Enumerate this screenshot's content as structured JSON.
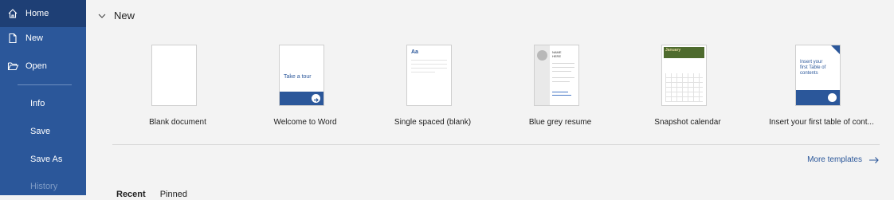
{
  "sidebar": {
    "items": [
      {
        "label": "Home",
        "icon": "home-icon"
      },
      {
        "label": "New",
        "icon": "new-document-icon"
      },
      {
        "label": "Open",
        "icon": "folder-open-icon"
      },
      {
        "label": "Info"
      },
      {
        "label": "Save"
      },
      {
        "label": "Save As"
      },
      {
        "label": "History"
      }
    ]
  },
  "main": {
    "section_title": "New",
    "templates": [
      {
        "label": "Blank document"
      },
      {
        "label": "Welcome to Word",
        "thumb_text": "Take a tour"
      },
      {
        "label": "Single spaced (blank)",
        "thumb_text": "Aa"
      },
      {
        "label": "Blue grey resume",
        "thumb_text": "NAME HERE"
      },
      {
        "label": "Snapshot calendar",
        "thumb_text": "January"
      },
      {
        "label": "Insert your first table of cont...",
        "thumb_text": "Insert your first Table of contents"
      }
    ],
    "more_templates": "More templates",
    "tabs": [
      "Recent",
      "Pinned"
    ]
  },
  "colors": {
    "sidebar": "#2b579a",
    "accent": "#2b579a",
    "background": "#f3f3f3"
  }
}
